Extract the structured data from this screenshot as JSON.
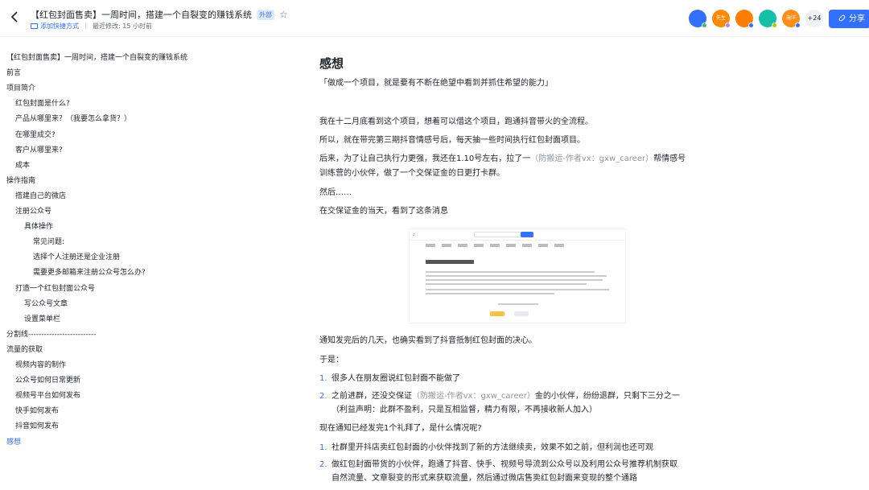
{
  "header": {
    "back_icon": "chevron-left-icon",
    "title": "【红包封面售卖】一周时间，搭建一个自裂变的赚钱系统",
    "external_badge": "外部",
    "add_shortcut": "添加快捷方式",
    "last_modified": "最近修改: 15 小时前",
    "avatars": [
      {
        "label": "",
        "color": "#3370ff",
        "dot": "#3dbb6d"
      },
      {
        "label": "先生",
        "color": "#ff8800",
        "dot": "#b37feb"
      },
      {
        "label": "",
        "color": "#ff7d00",
        "dot": "#3370ff"
      },
      {
        "label": "",
        "color": "#14c0a8",
        "dot": "#a6d000"
      },
      {
        "label": "海洋",
        "color": "#ff8d1a",
        "dot": "#3370ff"
      }
    ],
    "more_count": "+24",
    "share_label": "分享"
  },
  "toc": [
    {
      "text": "【红包封面售卖】一周时间，搭建一个自裂变的赚钱系统",
      "level": 0
    },
    {
      "text": "前言",
      "level": 0
    },
    {
      "text": "项目简介",
      "level": 0
    },
    {
      "text": "红包封面是什么?",
      "level": 1
    },
    {
      "text": "产品从哪里来？（我要怎么拿货？）",
      "level": 1
    },
    {
      "text": "在哪里成交?",
      "level": 1
    },
    {
      "text": "客户从哪里来?",
      "level": 1
    },
    {
      "text": "成本",
      "level": 1
    },
    {
      "text": "操作指南",
      "level": 0
    },
    {
      "text": "搭建自己的微店",
      "level": 1
    },
    {
      "text": "注册公众号",
      "level": 1
    },
    {
      "text": "具体操作",
      "level": 2
    },
    {
      "text": "常见问题:",
      "level": 3
    },
    {
      "text": "选择个人注册还是企业注册",
      "level": 3
    },
    {
      "text": "需要更多邮箱来注册公众号怎么办?",
      "level": 3
    },
    {
      "text": "打造一个红包封面公众号",
      "level": 1
    },
    {
      "text": "写公众号文章",
      "level": 2
    },
    {
      "text": "设置菜单栏",
      "level": 2
    },
    {
      "text": "分割线--------------------------",
      "level": 0
    },
    {
      "text": "流量的获取",
      "level": 0
    },
    {
      "text": "视频内容的制作",
      "level": 1
    },
    {
      "text": "公众号如何日常更新",
      "level": 1
    },
    {
      "text": "视频号平台如何发布",
      "level": 1
    },
    {
      "text": "快手如何发布",
      "level": 1
    },
    {
      "text": "抖音如何发布",
      "level": 1
    },
    {
      "text": "感想",
      "level": 0,
      "active": true
    }
  ],
  "content": {
    "heading": "感想",
    "quote": "「做成一个项目，就是要有不断在绝望中看到并抓住希望的能力」",
    "p1": "我在十二月底看到这个项目，想着可以借这个项目，跑通抖音带火的全流程。",
    "p2": "所以，就在带完第三期抖音情感号后，每天抽一些时间执行红包封面项目。",
    "p3a": "后来，为了让自己执行力更强，我还在1.10号左右，拉了一",
    "p3b": "（防搬运-作者vx：gxw_career）",
    "p3c": "帮情感号",
    "p3d": "训练营的小伙伴，做了一个交保证金的日更打卡群。",
    "p4": "然后……",
    "p5": "在交保证金的当天，看到了这条消息",
    "screenshot_title": "微信红包封面专项治理公告",
    "p6": "通知发完后的几天，也确实看到了抖音抵制红包封面的决心。",
    "p7": "于是：",
    "list1": [
      {
        "num": "1.",
        "text": "很多人在朋友圈说红包封面不能做了"
      },
      {
        "num": "2.",
        "text_a": "之前进群，还没交保证",
        "text_b": "（防搬运-作者vx：gxw_career）",
        "text_c": "金的小伙伴，纷纷退群，只剩下三分之一",
        "text_d": "（利益声明：此群不盈利，只是互相监督，精力有限，不再接收新人加入）"
      }
    ],
    "p8": "现在通知已经发完1个礼拜了，是什么情况呢?",
    "list2": [
      {
        "num": "1.",
        "text": "社群里开抖店卖红包封面的小伙伴找到了新的方法继续卖，效果不如之前，但利润也还可观"
      },
      {
        "num": "2.",
        "text_a": "做红包封面带货的小伙伴，跑通了抖音、快手、视频号导流到公众号以及利用公众号推荐机制获取",
        "text_b": "自然流量、文章裂变的形式来获取流量，然后通过微店售卖红包封面来变现的整个通路"
      }
    ]
  }
}
